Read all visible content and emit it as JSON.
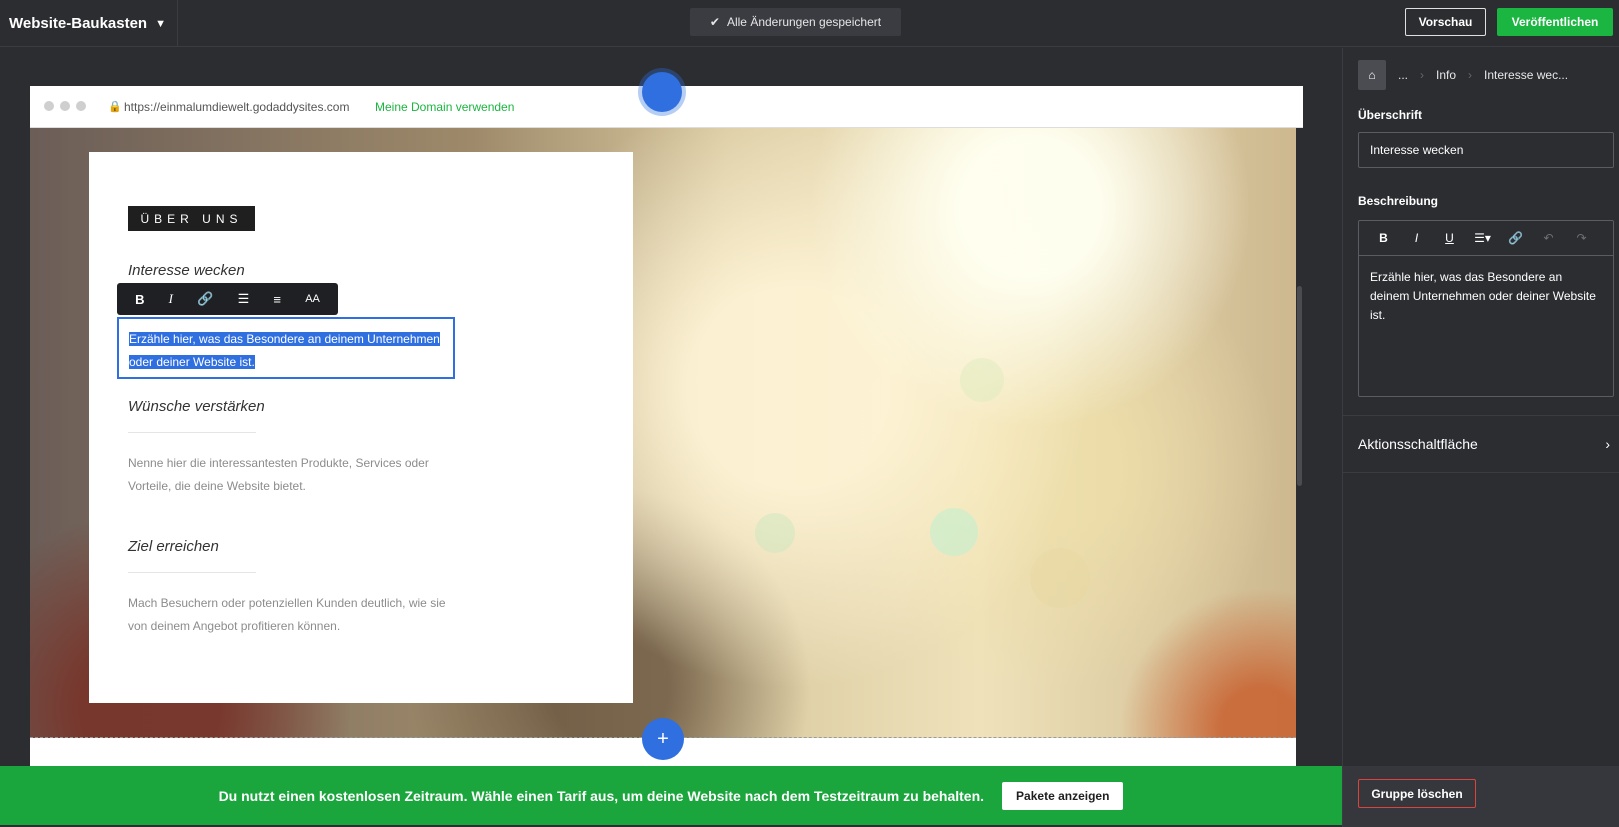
{
  "header": {
    "app_name": "Website-Baukasten",
    "saved_status": "Alle Änderungen gespeichert",
    "preview_label": "Vorschau",
    "publish_label": "Veröffentlichen"
  },
  "browser": {
    "url": "https://einmalumdiewelt.godaddysites.com",
    "domain_link": "Meine Domain verwenden"
  },
  "section": {
    "tag": "ÜBER UNS",
    "items": [
      {
        "heading": "Interesse wecken",
        "text": "Erzähle hier, was das Besondere an deinem Unternehmen oder deiner Website ist."
      },
      {
        "heading": "Wünsche verstärken",
        "text": "Nenne hier die interessantesten Produkte, Services oder Vorteile, die deine Website bietet."
      },
      {
        "heading": "Ziel erreichen",
        "text": "Mach Besuchern oder potenziellen Kunden deutlich, wie sie von deinem Angebot profitieren können."
      }
    ]
  },
  "toolbar": {
    "bold": "B",
    "italic": "I",
    "font_size": "AA"
  },
  "banner": {
    "message": "Du nutzt einen kostenlosen Zeitraum. Wähle einen Tarif aus, um deine Website nach dem Testzeitraum zu behalten.",
    "button": "Pakete anzeigen"
  },
  "panel": {
    "breadcrumbs": [
      "...",
      "Info",
      "Interesse wec..."
    ],
    "heading_label": "Überschrift",
    "heading_value": "Interesse wecken",
    "description_label": "Beschreibung",
    "description_value": "Erzähle hier, was das Besondere an deinem Unternehmen oder deiner Website ist.",
    "rte_tools": {
      "bold": "B",
      "italic": "I",
      "underline": "U"
    },
    "action_label": "Aktionsschaltfläche",
    "delete_label": "Gruppe löschen"
  },
  "colors": {
    "accent_blue": "#2f6fe0",
    "brand_green": "#1bb541",
    "dark_bg": "#2b2d31"
  }
}
